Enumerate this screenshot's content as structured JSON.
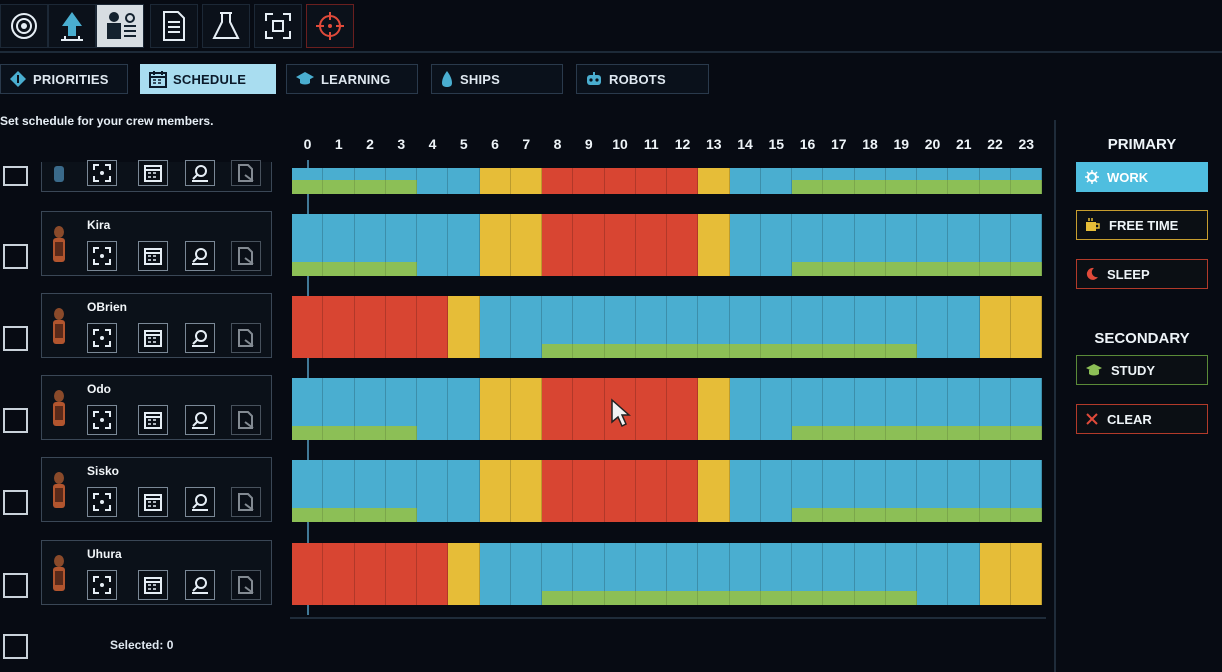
{
  "toolbar": {
    "icons": [
      "target-icon",
      "arrow-up-icon",
      "crew-icon",
      "document-icon",
      "flask-icon",
      "focus-icon",
      "crosshair-icon"
    ],
    "active_index": 2
  },
  "tabs": [
    {
      "label": "PRIORITIES",
      "icon": "diamond-info-icon"
    },
    {
      "label": "SCHEDULE",
      "icon": "calendar-icon",
      "active": true
    },
    {
      "label": "LEARNING",
      "icon": "graduation-cap-icon"
    },
    {
      "label": "SHIPS",
      "icon": "ship-icon"
    },
    {
      "label": "ROBOTS",
      "icon": "robot-icon"
    }
  ],
  "hint": "Set schedule for your crew members.",
  "hours": [
    "0",
    "1",
    "2",
    "3",
    "4",
    "5",
    "6",
    "7",
    "8",
    "9",
    "10",
    "11",
    "12",
    "13",
    "14",
    "15",
    "16",
    "17",
    "18",
    "19",
    "20",
    "21",
    "22",
    "23"
  ],
  "colors": {
    "work": "#4aaed0",
    "free_time": "#e6bd38",
    "sleep": "#d84532",
    "study": "#8cbf56"
  },
  "crew": [
    {
      "name": "",
      "partial": true,
      "primary": [
        "work",
        "work",
        "work",
        "work",
        "work",
        "work",
        "free",
        "free",
        "sleep",
        "sleep",
        "sleep",
        "sleep",
        "sleep",
        "free",
        "work",
        "work",
        "work",
        "work",
        "work",
        "work",
        "work",
        "work",
        "work",
        "work"
      ],
      "secondary": [
        1,
        1,
        1,
        1,
        0,
        0,
        0,
        0,
        0,
        0,
        0,
        0,
        0,
        0,
        0,
        0,
        1,
        1,
        1,
        1,
        1,
        1,
        1,
        1
      ]
    },
    {
      "name": "Kira",
      "primary": [
        "work",
        "work",
        "work",
        "work",
        "work",
        "work",
        "free",
        "free",
        "sleep",
        "sleep",
        "sleep",
        "sleep",
        "sleep",
        "free",
        "work",
        "work",
        "work",
        "work",
        "work",
        "work",
        "work",
        "work",
        "work",
        "work"
      ],
      "secondary": [
        1,
        1,
        1,
        1,
        0,
        0,
        0,
        0,
        0,
        0,
        0,
        0,
        0,
        0,
        0,
        0,
        1,
        1,
        1,
        1,
        1,
        1,
        1,
        1
      ]
    },
    {
      "name": "OBrien",
      "primary": [
        "sleep",
        "sleep",
        "sleep",
        "sleep",
        "sleep",
        "free",
        "work",
        "work",
        "work",
        "work",
        "work",
        "work",
        "work",
        "work",
        "work",
        "work",
        "work",
        "work",
        "work",
        "work",
        "work",
        "work",
        "free",
        "free"
      ],
      "secondary": [
        0,
        0,
        0,
        0,
        0,
        0,
        0,
        0,
        1,
        1,
        1,
        1,
        1,
        1,
        1,
        1,
        1,
        1,
        1,
        1,
        0,
        0,
        0,
        0
      ]
    },
    {
      "name": "Odo",
      "primary": [
        "work",
        "work",
        "work",
        "work",
        "work",
        "work",
        "free",
        "free",
        "sleep",
        "sleep",
        "sleep",
        "sleep",
        "sleep",
        "free",
        "work",
        "work",
        "work",
        "work",
        "work",
        "work",
        "work",
        "work",
        "work",
        "work"
      ],
      "secondary": [
        1,
        1,
        1,
        1,
        0,
        0,
        0,
        0,
        0,
        0,
        0,
        0,
        0,
        0,
        0,
        0,
        1,
        1,
        1,
        1,
        1,
        1,
        1,
        1
      ]
    },
    {
      "name": "Sisko",
      "primary": [
        "work",
        "work",
        "work",
        "work",
        "work",
        "work",
        "free",
        "free",
        "sleep",
        "sleep",
        "sleep",
        "sleep",
        "sleep",
        "free",
        "work",
        "work",
        "work",
        "work",
        "work",
        "work",
        "work",
        "work",
        "work",
        "work"
      ],
      "secondary": [
        1,
        1,
        1,
        1,
        0,
        0,
        0,
        0,
        0,
        0,
        0,
        0,
        0,
        0,
        0,
        0,
        1,
        1,
        1,
        1,
        1,
        1,
        1,
        1
      ]
    },
    {
      "name": "Uhura",
      "primary": [
        "sleep",
        "sleep",
        "sleep",
        "sleep",
        "sleep",
        "free",
        "work",
        "work",
        "work",
        "work",
        "work",
        "work",
        "work",
        "work",
        "work",
        "work",
        "work",
        "work",
        "work",
        "work",
        "work",
        "work",
        "free",
        "free"
      ],
      "secondary": [
        0,
        0,
        0,
        0,
        0,
        0,
        0,
        0,
        1,
        1,
        1,
        1,
        1,
        1,
        1,
        1,
        1,
        1,
        1,
        1,
        0,
        0,
        0,
        0
      ]
    }
  ],
  "card_icons": [
    "focus-icon",
    "calendar-icon",
    "inspect-icon",
    "document-edit-icon"
  ],
  "panel": {
    "primary_title": "PRIMARY",
    "work": "WORK",
    "free_time": "FREE TIME",
    "sleep": "SLEEP",
    "secondary_title": "SECONDARY",
    "study": "STUDY",
    "clear": "CLEAR"
  },
  "selected_label": "Selected: 0"
}
